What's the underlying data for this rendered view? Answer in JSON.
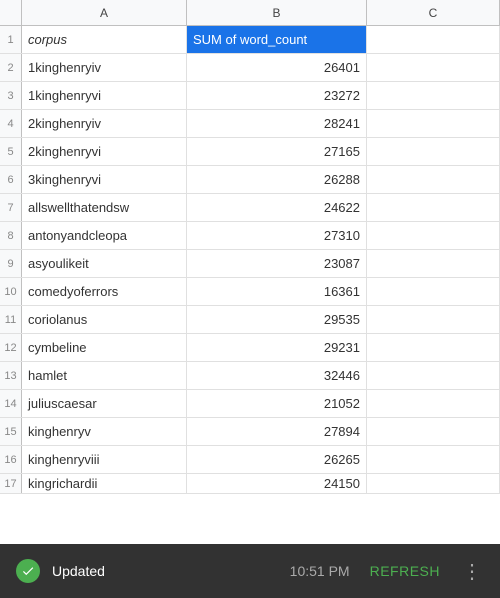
{
  "columns": {
    "a": "A",
    "b": "B",
    "c": "C"
  },
  "header": {
    "col_a": "corpus",
    "col_b": "SUM of word_count"
  },
  "rows": [
    {
      "num": "2",
      "corpus": "1kinghenryiv",
      "value": "26401"
    },
    {
      "num": "3",
      "corpus": "1kinghenryvi",
      "value": "23272"
    },
    {
      "num": "4",
      "corpus": "2kinghenryiv",
      "value": "28241"
    },
    {
      "num": "5",
      "corpus": "2kinghenryvi",
      "value": "27165"
    },
    {
      "num": "6",
      "corpus": "3kinghenryvi",
      "value": "26288"
    },
    {
      "num": "7",
      "corpus": "allswellthatendsw",
      "value": "24622"
    },
    {
      "num": "8",
      "corpus": "antonyandcleopa",
      "value": "27310"
    },
    {
      "num": "9",
      "corpus": "asyoulikeit",
      "value": "23087"
    },
    {
      "num": "10",
      "corpus": "comedyoferrors",
      "value": "16361"
    },
    {
      "num": "11",
      "corpus": "coriolanus",
      "value": "29535"
    },
    {
      "num": "12",
      "corpus": "cymbeline",
      "value": "29231"
    },
    {
      "num": "13",
      "corpus": "hamlet",
      "value": "32446"
    },
    {
      "num": "14",
      "corpus": "juliuscaesar",
      "value": "21052"
    },
    {
      "num": "15",
      "corpus": "kinghenryv",
      "value": "27894"
    },
    {
      "num": "16",
      "corpus": "kinghenryviii",
      "value": "26265"
    },
    {
      "num": "17",
      "corpus": "kingrichardii",
      "value": "24150"
    }
  ],
  "notification": {
    "status": "Updated",
    "time": "10:51 PM",
    "refresh_label": "Refresh"
  }
}
